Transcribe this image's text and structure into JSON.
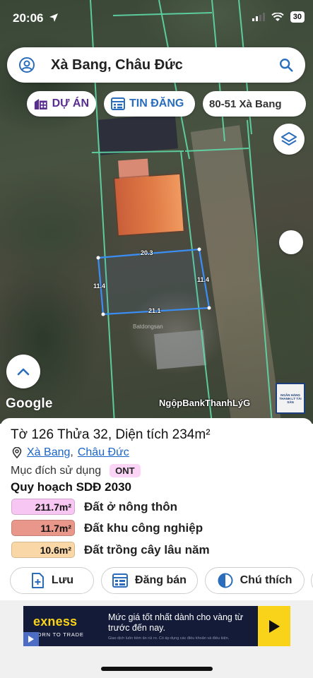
{
  "status_bar": {
    "time": "20:06",
    "battery": "30"
  },
  "search": {
    "query": "Xà Bang, Châu Đức"
  },
  "chips": {
    "project": "DỰ ÁN",
    "listings": "TIN ĐĂNG",
    "address": "80-51 Xà Bang"
  },
  "map": {
    "edge_top": "20.3",
    "edge_left": "11.4",
    "edge_right": "11.4",
    "edge_bottom": "21.1",
    "watermark": "Batdongsan",
    "google_logo": "Google",
    "credit_text": "NgộpBankThanhLýG",
    "bank_sign_lines": [
      "NGÂN HÀNG",
      "THANH LÝ TÀI SẢN"
    ]
  },
  "parcel": {
    "title": "Tờ 126 Thửa 32, Diện tích 234m²",
    "commune": "Xà Bang",
    "district": "Châu Đức",
    "purpose_label": "Mục đích sử dụng",
    "purpose_code": "ONT",
    "plan_title": "Quy hoạch SDĐ 2030",
    "land_uses": [
      {
        "area": "211.7m²",
        "name": "Đất ở nông thôn",
        "color": "#f7c6f2"
      },
      {
        "area": "11.7m²",
        "name": "Đất khu công nghiệp",
        "color": "#e8978a"
      },
      {
        "area": "10.6m²",
        "name": "Đất trồng cây lâu năm",
        "color": "#fad7a6"
      }
    ]
  },
  "actions": {
    "save": "Lưu",
    "post_sale": "Đăng bán",
    "legend": "Chú thích"
  },
  "ad": {
    "brand": "exness",
    "tagline": "BORN TO TRADE",
    "headline": "Mức giá tốt nhất dành cho vàng từ trước đến nay.",
    "disclaimer": "Giao dịch luôn tiềm ẩn rủi ro. Có áp dụng các điều khoản và điều kiện."
  },
  "colors": {
    "parcel_outline": "#3a8ef6",
    "cadastral_lines": "#5fd9a8",
    "project_chip": "#5a2d91",
    "listing_chip": "#2a6dbd",
    "link": "#1a64c8",
    "ad_background": "#141b38",
    "ad_accent": "#f9d21a"
  }
}
